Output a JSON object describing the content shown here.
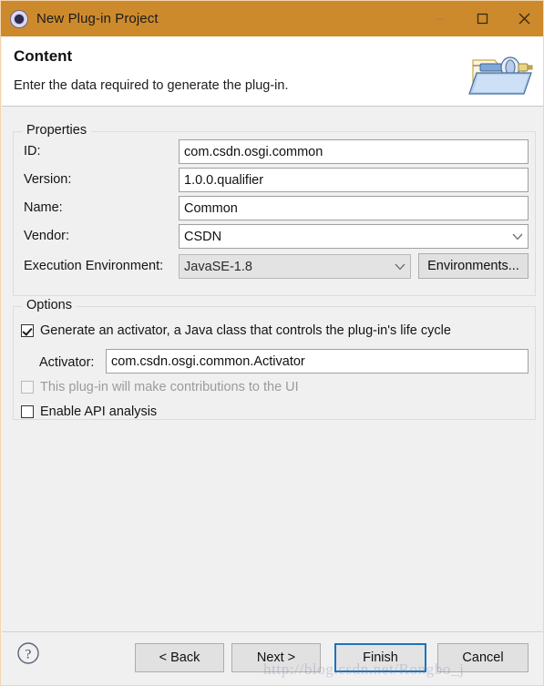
{
  "window": {
    "title": "New Plug-in Project",
    "icon": "plugin-gear-icon",
    "titlebar_color": "#cd8a2c",
    "controls": {
      "minimize": "—",
      "maximize": "□",
      "close": "✕"
    }
  },
  "header": {
    "title": "Content",
    "subtitle": "Enter the data required to generate the plug-in.",
    "banner_icon": "plugin-folder-icon"
  },
  "properties": {
    "group_label": "Properties",
    "fields": [
      {
        "label": "ID:",
        "value": "com.csdn.osgi.common",
        "type": "text"
      },
      {
        "label": "Version:",
        "value": "1.0.0.qualifier",
        "type": "text"
      },
      {
        "label": "Name:",
        "value": "Common",
        "type": "text"
      },
      {
        "label": "Vendor:",
        "value": "CSDN",
        "type": "combo"
      }
    ],
    "execution_environment": {
      "label": "Execution Environment:",
      "value": "JavaSE-1.8",
      "disabled": true,
      "button_label": "Environments..."
    }
  },
  "options": {
    "group_label": "Options",
    "generate_activator": {
      "label": "Generate an activator, a Java class that controls the plug-in's life cycle",
      "checked": true,
      "enabled": true
    },
    "activator": {
      "label": "Activator:",
      "value": "com.csdn.osgi.common.Activator"
    },
    "ui_contributions": {
      "label": "This plug-in will make contributions to the UI",
      "checked": false,
      "enabled": false
    },
    "api_analysis": {
      "label": "Enable API analysis",
      "checked": false,
      "enabled": true
    }
  },
  "footer": {
    "help_icon": "help-question-icon",
    "buttons": [
      {
        "label": "< Back",
        "default": false
      },
      {
        "label": "Next >",
        "default": false
      },
      {
        "label": "Finish",
        "default": true
      },
      {
        "label": "Cancel",
        "default": false
      }
    ],
    "default_button_color": "#1b74bb"
  },
  "watermark": "http://blog.csdn.net/Rongbo_j"
}
